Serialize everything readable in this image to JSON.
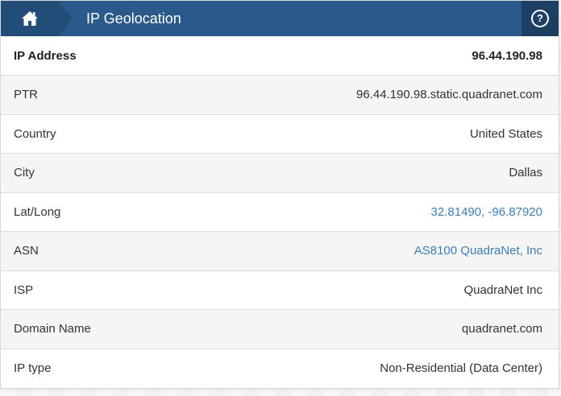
{
  "header": {
    "title": "IP Geolocation",
    "help_symbol": "?"
  },
  "rows": [
    {
      "label": "IP Address",
      "value": "96.44.190.98"
    },
    {
      "label": "PTR",
      "value": "96.44.190.98.static.quadranet.com"
    },
    {
      "label": "Country",
      "value": "United States"
    },
    {
      "label": "City",
      "value": "Dallas"
    },
    {
      "label": "Lat/Long",
      "value": "32.81490, -96.87920"
    },
    {
      "label": "ASN",
      "value": "AS8100 QuadraNet, Inc"
    },
    {
      "label": "ISP",
      "value": "QuadraNet Inc"
    },
    {
      "label": "Domain Name",
      "value": "quadranet.com"
    },
    {
      "label": "IP type",
      "value": "Non-Residential (Data Center)"
    }
  ],
  "colors": {
    "header_bg": "#2a5a8b",
    "home_bg": "#234d79",
    "help_bg": "#1d3f64",
    "link": "#3e7fb8"
  },
  "icons": {
    "home": "home-icon",
    "help": "help-circle-icon"
  }
}
